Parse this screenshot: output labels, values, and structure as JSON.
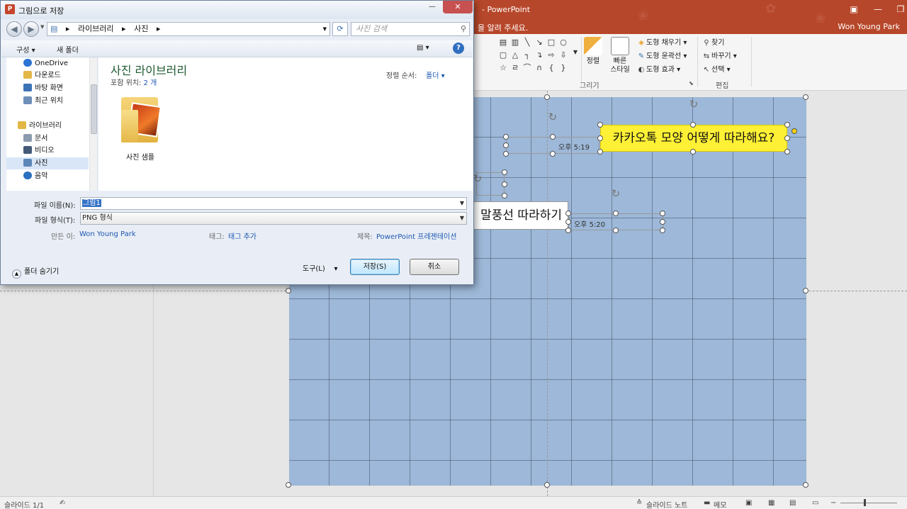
{
  "powerpoint": {
    "title_suffix": "- PowerPoint",
    "tell_me": "을 알려 주세요.",
    "user": "Won Young Park",
    "ribbon": {
      "arrange_label": "정렬",
      "quick_styles_line1": "빠른",
      "quick_styles_line2": "스타일",
      "shape_fill": "도형 채우기",
      "shape_outline": "도형 윤곽선",
      "shape_effects": "도형 효과",
      "group_drawing": "그리기",
      "find": "찾기",
      "replace": "바꾸기",
      "select": "선택",
      "group_editing": "편집"
    },
    "slide": {
      "bubble_yellow": "카카오톡 모양 어떻게 따라해요?",
      "bubble_white": "말풍선 따라하기",
      "time_1": "오후 5:19",
      "time_2": "오후 5:20"
    },
    "status": {
      "slide_count": "슬라이드 1/1",
      "notes": "슬라이드 노트",
      "comments": "메모"
    }
  },
  "dialog": {
    "title": "그림으로 저장",
    "breadcrumb": [
      "라이브러리",
      "사진"
    ],
    "search_placeholder": "사진 검색",
    "toolbar": {
      "organize": "구성",
      "new_folder": "새 폴더"
    },
    "nav_items": [
      {
        "label": "OneDrive",
        "icon": "cloud-icon",
        "color": "#2a74d4"
      },
      {
        "label": "다운로드",
        "icon": "downloads-icon",
        "color": "#e3b646"
      },
      {
        "label": "바탕 화면",
        "icon": "desktop-icon",
        "color": "#3b73b6"
      },
      {
        "label": "최근 위치",
        "icon": "recent-places-icon",
        "color": "#6d8fb8"
      },
      {
        "label": "라이브러리",
        "icon": "libraries-icon",
        "color": "#e3b646"
      },
      {
        "label": "문서",
        "icon": "documents-icon",
        "color": "#8b9bb0"
      },
      {
        "label": "비디오",
        "icon": "videos-icon",
        "color": "#445a78"
      },
      {
        "label": "사진",
        "icon": "pictures-icon",
        "color": "#5b86b8"
      },
      {
        "label": "음악",
        "icon": "music-icon",
        "color": "#2a6fc0"
      }
    ],
    "library_title": "사진 라이브러리",
    "library_includes_label": "포함 위치:",
    "library_includes_value": "2 개",
    "sort_label": "정렬 순서:",
    "sort_value": "폴더",
    "folder_name": "사진 샘플",
    "filename_label": "파일 이름(N):",
    "filename_value": "그림1",
    "filetype_label": "파일 형식(T):",
    "filetype_value": "PNG 형식",
    "author_label": "만든 이:",
    "author_value": "Won Young Park",
    "tags_label": "태그:",
    "tags_value": "태그 추가",
    "title_label": "제목:",
    "title_value": "PowerPoint 프레젠테이션",
    "hide_folders": "폴더 숨기기",
    "tools": "도구(L)",
    "save": "저장(S)",
    "cancel": "취소"
  }
}
